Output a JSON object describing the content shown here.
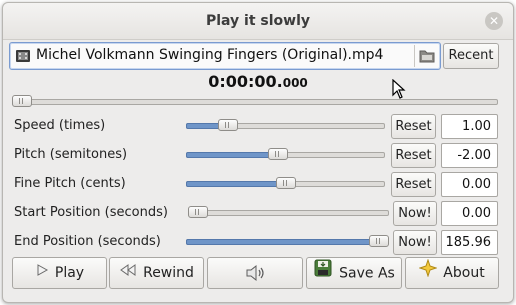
{
  "window": {
    "title": "Play it slowly"
  },
  "file": {
    "name": "Michel Volkmann Swinging Fingers (Original).mp4",
    "recent_label": "Recent"
  },
  "playback": {
    "time_main": "0:00:00.",
    "time_ms": "000",
    "position_fraction": 0.0
  },
  "controls": [
    {
      "label": "Speed (times)",
      "button": "Reset",
      "value": "1.00",
      "fraction": 0.18
    },
    {
      "label": "Pitch (semitones)",
      "button": "Reset",
      "value": "-2.00",
      "fraction": 0.46
    },
    {
      "label": "Fine Pitch (cents)",
      "button": "Reset",
      "value": "0.00",
      "fraction": 0.5
    },
    {
      "label": "Start Position (seconds)",
      "button": "Now!",
      "value": "0.00",
      "fraction": 0.0
    },
    {
      "label": "End Position (seconds)",
      "button": "Now!",
      "value": "185.96",
      "fraction": 1.0
    }
  ],
  "bottom_buttons": {
    "play": "Play",
    "rewind": "Rewind",
    "save_as": "Save As",
    "about": "About"
  },
  "colors": {
    "accent": "#6f95c8",
    "window_bg": "#edeceb"
  }
}
